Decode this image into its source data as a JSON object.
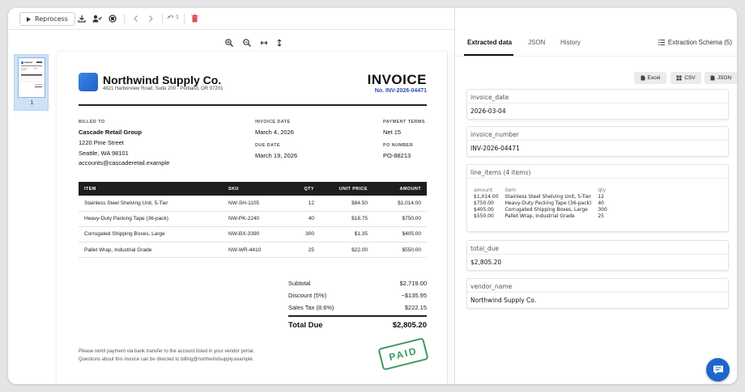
{
  "toolbar": {
    "reprocess_label": "Reprocess",
    "page_indicator": "1"
  },
  "thumbnails": [
    {
      "page_number": "1"
    }
  ],
  "invoice": {
    "company_name": "Northwind Supply Co.",
    "company_address": "4821 Harborview Road, Suite 200 · Portland, OR 97201",
    "title": "INVOICE",
    "number": "No. INV-2026-04471",
    "billed_to_label": "BILLED TO",
    "billed_to": {
      "name": "Cascade Retail Group",
      "street": "1220 Pine Street",
      "city": "Seattle, WA 98101",
      "email": "accounts@cascaderetail.example"
    },
    "invoice_date_label": "INVOICE DATE",
    "invoice_date": "March 4, 2026",
    "due_date_label": "DUE DATE",
    "due_date": "March 19, 2026",
    "payment_terms_label": "PAYMENT TERMS",
    "payment_terms": "Net 15",
    "po_number_label": "PO NUMBER",
    "po_number": "PO-88213",
    "table_headers": {
      "item": "ITEM",
      "sku": "SKU",
      "qty": "QTY",
      "unit_price": "UNIT PRICE",
      "amount": "AMOUNT"
    },
    "line_items": [
      {
        "item": "Stainless Steel Shelving Unit, 5-Tier",
        "sku": "NW-SH-1105",
        "qty": "12",
        "unit_price": "$84.50",
        "amount": "$1,014.00"
      },
      {
        "item": "Heavy-Duty Packing Tape (36-pack)",
        "sku": "NW-PK-2240",
        "qty": "40",
        "unit_price": "$18.75",
        "amount": "$750.00"
      },
      {
        "item": "Corrugated Shipping Boxes, Large",
        "sku": "NW-BX-3390",
        "qty": "300",
        "unit_price": "$1.35",
        "amount": "$405.00"
      },
      {
        "item": "Pallet Wrap, Industrial Grade",
        "sku": "NW-WR-4410",
        "qty": "25",
        "unit_price": "$22.00",
        "amount": "$550.00"
      }
    ],
    "totals": {
      "subtotal_label": "Subtotal",
      "subtotal": "$2,719.00",
      "discount_label": "Discount (5%)",
      "discount": "−$135.95",
      "tax_label": "Sales Tax (8.6%)",
      "tax": "$222.15",
      "total_label": "Total Due",
      "total": "$2,805.20"
    },
    "footer_line1": "Please remit payment via bank transfer to the account listed in your vendor portal.",
    "footer_line2": "Questions about this invoice can be directed to billing@northwindsupply.example.",
    "stamp": "PAID"
  },
  "panel": {
    "tabs": [
      "Extracted data",
      "JSON",
      "History"
    ],
    "active_tab": "Extracted data",
    "schema_button": "Extraction Schema (5)",
    "export_buttons": [
      "Excel",
      "CSV",
      "JSON"
    ],
    "fields": {
      "invoice_date": {
        "key": "invoice_date",
        "value": "2026-03-04"
      },
      "invoice_number": {
        "key": "invoice_number",
        "value": "INV-2026-04471"
      },
      "line_items": {
        "key": "line_items (4 items)",
        "columns": [
          "amount",
          "item",
          "qty"
        ],
        "rows": [
          [
            "$1,014.00",
            "Stainless Steel Shelving Unit, 5-Tier",
            "12"
          ],
          [
            "$750.00",
            "Heavy-Duty Packing Tape (36-pack)",
            "40"
          ],
          [
            "$405.00",
            "Corrugated Shipping Boxes, Large",
            "300"
          ],
          [
            "$550.00",
            "Pallet Wrap, Industrial Grade",
            "25"
          ]
        ]
      },
      "total_due": {
        "key": "total_due",
        "value": "$2,805.20"
      },
      "vendor_name": {
        "key": "vendor_name",
        "value": "Northwind Supply Co."
      }
    }
  },
  "colors": {
    "accent": "#1f66c9",
    "invoice_number": "#2a4fb0",
    "stamp": "#3a9a5a",
    "table_header": "#1e1e1e"
  },
  "icons": [
    "play-icon",
    "download-icon",
    "user-check-icon",
    "settings-icon",
    "chevron-left-icon",
    "chevron-right-icon",
    "link-icon",
    "trash-icon",
    "zoom-in-icon",
    "zoom-out-icon",
    "fit-width-icon",
    "fit-height-icon",
    "list-icon",
    "file-icon",
    "chat-icon"
  ]
}
